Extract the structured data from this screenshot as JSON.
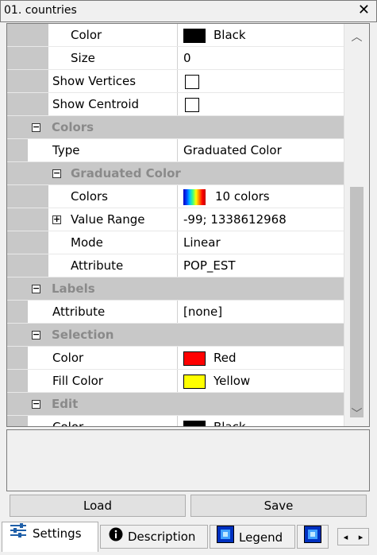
{
  "window": {
    "title": "01. countries",
    "close_glyph": "✕"
  },
  "properties": {
    "rows": [
      {
        "label": "Color",
        "value": "Black",
        "swatch": "#000000"
      },
      {
        "label": "Size",
        "value": "0"
      },
      {
        "label": "Show Vertices"
      },
      {
        "label": "Show Centroid"
      }
    ],
    "colors_category": "Colors",
    "type_label": "Type",
    "type_value": "Graduated Color",
    "graduated_category": "Graduated Color",
    "graduated": {
      "colors_label": "Colors",
      "colors_value": "10 colors",
      "range_label": "Value Range",
      "range_value": "-99; 1338612968",
      "mode_label": "Mode",
      "mode_value": "Linear",
      "attribute_label": "Attribute",
      "attribute_value": "POP_EST"
    },
    "labels_category": "Labels",
    "labels_attribute_label": "Attribute",
    "labels_attribute_value": "[none]",
    "selection_category": "Selection",
    "selection_color_label": "Color",
    "selection_color_value": "Red",
    "selection_color_swatch": "#ff0000",
    "selection_fill_label": "Fill Color",
    "selection_fill_value": "Yellow",
    "selection_fill_swatch": "#ffff00",
    "edit_category": "Edit",
    "edit_color_label": "Color",
    "edit_color_value": "Black"
  },
  "buttons": {
    "load": "Load",
    "save": "Save"
  },
  "tabs": [
    {
      "label": "Settings",
      "icon": "sliders-icon"
    },
    {
      "label": "Description",
      "icon": "info-icon"
    },
    {
      "label": "Legend",
      "icon": "legend-icon"
    }
  ]
}
